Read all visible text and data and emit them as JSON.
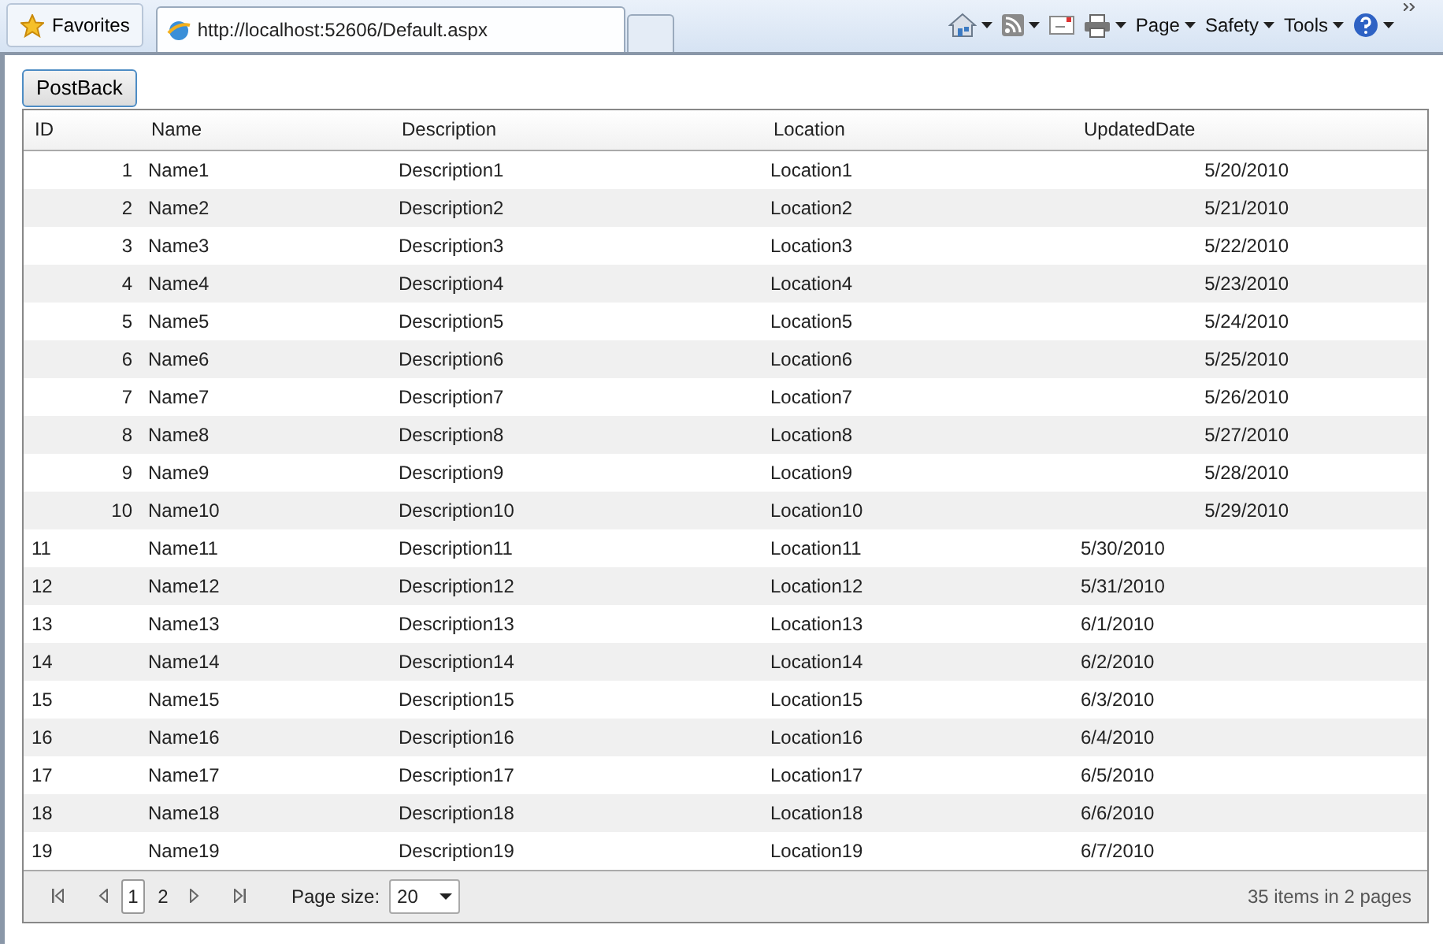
{
  "browser": {
    "favorites": "Favorites",
    "tabs": [
      {
        "label": "http://localhost:52606/Default.aspx",
        "selected": true
      }
    ],
    "commands": [
      "Page",
      "Safety",
      "Tools"
    ]
  },
  "postback_button": "PostBack",
  "grid": {
    "columns": [
      "ID",
      "Name",
      "Description",
      "Location",
      "UpdatedDate"
    ],
    "rows": [
      {
        "kind": "right",
        "cells": [
          "1",
          "Name1",
          "Description1",
          "Location1",
          "5/20/2010"
        ]
      },
      {
        "kind": "right",
        "cells": [
          "2",
          "Name2",
          "Description2",
          "Location2",
          "5/21/2010"
        ]
      },
      {
        "kind": "right",
        "cells": [
          "3",
          "Name3",
          "Description3",
          "Location3",
          "5/22/2010"
        ]
      },
      {
        "kind": "right",
        "cells": [
          "4",
          "Name4",
          "Description4",
          "Location4",
          "5/23/2010"
        ]
      },
      {
        "kind": "right",
        "cells": [
          "5",
          "Name5",
          "Description5",
          "Location5",
          "5/24/2010"
        ]
      },
      {
        "kind": "right",
        "cells": [
          "6",
          "Name6",
          "Description6",
          "Location6",
          "5/25/2010"
        ]
      },
      {
        "kind": "right",
        "cells": [
          "7",
          "Name7",
          "Description7",
          "Location7",
          "5/26/2010"
        ]
      },
      {
        "kind": "right",
        "cells": [
          "8",
          "Name8",
          "Description8",
          "Location8",
          "5/27/2010"
        ]
      },
      {
        "kind": "right",
        "cells": [
          "9",
          "Name9",
          "Description9",
          "Location9",
          "5/28/2010"
        ]
      },
      {
        "kind": "right",
        "cells": [
          "10",
          "Name10",
          "Description10",
          "Location10",
          "5/29/2010"
        ]
      },
      {
        "kind": "left",
        "cells": [
          "11",
          "Name11",
          "Description11",
          "Location11",
          "5/30/2010"
        ]
      },
      {
        "kind": "left",
        "cells": [
          "12",
          "Name12",
          "Description12",
          "Location12",
          "5/31/2010"
        ]
      },
      {
        "kind": "left",
        "cells": [
          "13",
          "Name13",
          "Description13",
          "Location13",
          "6/1/2010"
        ]
      },
      {
        "kind": "left",
        "cells": [
          "14",
          "Name14",
          "Description14",
          "Location14",
          "6/2/2010"
        ]
      },
      {
        "kind": "left",
        "cells": [
          "15",
          "Name15",
          "Description15",
          "Location15",
          "6/3/2010"
        ]
      },
      {
        "kind": "left",
        "cells": [
          "16",
          "Name16",
          "Description16",
          "Location16",
          "6/4/2010"
        ]
      },
      {
        "kind": "left",
        "cells": [
          "17",
          "Name17",
          "Description17",
          "Location17",
          "6/5/2010"
        ]
      },
      {
        "kind": "left",
        "cells": [
          "18",
          "Name18",
          "Description18",
          "Location18",
          "6/6/2010"
        ]
      },
      {
        "kind": "left",
        "cells": [
          "19",
          "Name19",
          "Description19",
          "Location19",
          "6/7/2010"
        ]
      }
    ]
  },
  "pager": {
    "pages": [
      {
        "label": "1",
        "selected": true
      },
      {
        "label": "2",
        "selected": false
      }
    ],
    "page_size_label": "Page size:",
    "page_size": "20",
    "summary": "35 items in 2 pages"
  }
}
